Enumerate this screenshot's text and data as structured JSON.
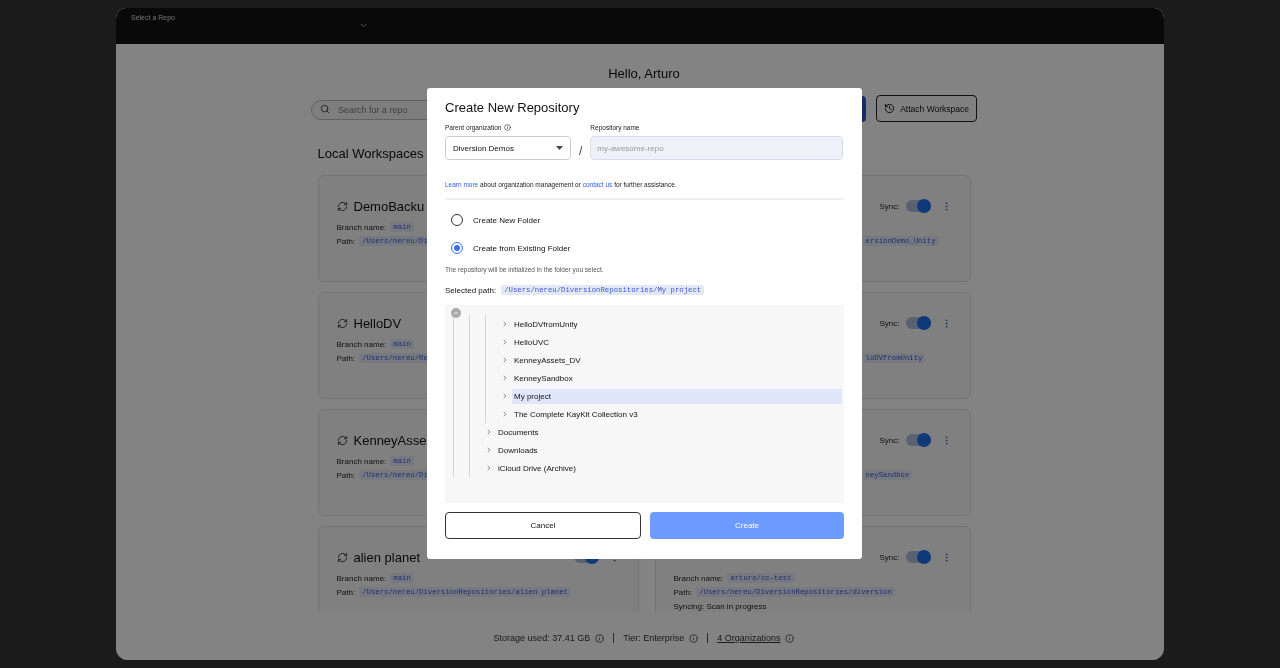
{
  "top_bar": {
    "repo_selector": "Select a Repo"
  },
  "greeting": "Hello, Arturo",
  "toolbar": {
    "search": {
      "placeholder": "Search for a repo"
    },
    "attach_button": "Attach Workspace"
  },
  "section_title": "Local Workspaces",
  "workspaces": [
    {
      "name": "DemoBacku",
      "branch_label": "Branch name:",
      "branch": "main",
      "path_label": "Path:",
      "path": "/Users/nereu/Di"
    },
    {
      "path": "ersionDemo_Unity",
      "sync_label": "Sync:",
      "sync_on": true
    },
    {
      "name": "HelloDV",
      "branch_label": "Branch name:",
      "branch": "main",
      "path_label": "Path:",
      "path": "/Users/nereu/Re"
    },
    {
      "path": "loDVfromUnity",
      "sync_label": "Sync:",
      "sync_on": true
    },
    {
      "name": "KenneyAsse",
      "branch_label": "Branch name:",
      "branch": "main",
      "path_label": "Path:",
      "path": "/Users/nereu/Di"
    },
    {
      "path": "neySandbox",
      "sync_label": "Sync:",
      "sync_on": true
    },
    {
      "name": "alien planet",
      "branch_label": "Branch name:",
      "branch": "main",
      "path_label": "Path:",
      "path": "/Users/nereu/DiversionRepositories/alien planet",
      "sync_on": true
    },
    {
      "branch_label": "Branch name:",
      "branch": "arturo/cc-test",
      "path_label": "Path:",
      "path": "/Users/nereu/DiversionRepositories/diversion",
      "sync_label": "Sync:",
      "sync_on": true,
      "syncing": "Syncing: Scan in progress"
    }
  ],
  "footer": [
    {
      "text": "Storage used: 37.41 GB",
      "link": false
    },
    {
      "text": "Tier: Enterprise",
      "link": false
    },
    {
      "text": "4 Organizations",
      "link": true
    }
  ],
  "dialog": {
    "title": "Create New Repository",
    "org_label": "Parent organization",
    "org_value": "Diversion Demos",
    "separator": "/",
    "name_label": "Repository name",
    "name_placeholder": "my-awesome-repo",
    "help": {
      "link1": "Learn more",
      "middle": " about organization management or ",
      "link2": "contact us",
      "end": " for further assistance."
    },
    "options": [
      {
        "label": "Create New Folder",
        "selected": false
      },
      {
        "label": "Create from Existing Folder",
        "selected": true
      }
    ],
    "hint": "The repository will be initialized in the folder you select.",
    "selected_path_label": "Selected path:",
    "selected_path": "/Users/nereu/DiversionRepositories/My project",
    "tree": [
      {
        "children": [
          {
            "children": [
              {
                "children": [
                  {
                    "label": "HelloDVfromUnity",
                    "selected": false
                  },
                  {
                    "label": "HelloUVC",
                    "selected": false
                  },
                  {
                    "label": "KenneyAssets_DV",
                    "selected": false
                  },
                  {
                    "label": "KenneySandbox",
                    "selected": false
                  },
                  {
                    "label": "My project",
                    "selected": true
                  },
                  {
                    "label": "The Complete KayKit Collection v3",
                    "selected": false
                  }
                ]
              },
              {
                "label": "Documents",
                "selected": false
              },
              {
                "label": "Downloads",
                "selected": false
              },
              {
                "label": "iCloud Drive (Archive)",
                "selected": false
              }
            ]
          }
        ]
      }
    ],
    "buttons": [
      {
        "label": "Cancel",
        "kind": "secondary",
        "disabled": false
      },
      {
        "label": "Create",
        "kind": "primary",
        "disabled": true
      }
    ]
  }
}
